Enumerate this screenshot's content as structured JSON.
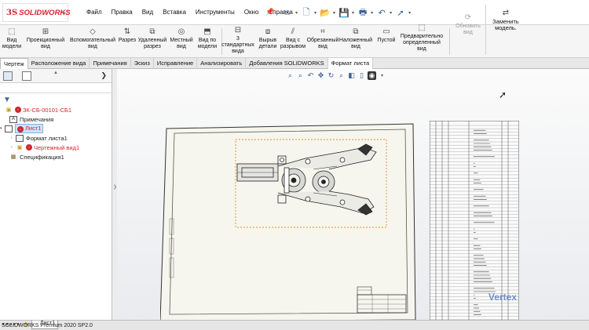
{
  "app": {
    "logo_ds": "3S",
    "logo_text": "SOLIDWORKS"
  },
  "menu": [
    "Файл",
    "Правка",
    "Вид",
    "Вставка",
    "Инструменты",
    "Окно",
    "Справка"
  ],
  "ribbon": {
    "buttons": [
      {
        "label": "Вид\nмодели",
        "icon": "model-view-icon"
      },
      {
        "label": "Проекционный\nвид",
        "icon": "projected-view-icon"
      },
      {
        "label": "Вспомогательный\nвид",
        "icon": "auxiliary-view-icon"
      },
      {
        "label": "Разрез",
        "icon": "section-view-icon"
      },
      {
        "label": "Удаленный\nразрез",
        "icon": "removed-section-icon"
      },
      {
        "label": "Местный\nвид",
        "icon": "detail-view-icon"
      },
      {
        "label": "Вид по\nмодели",
        "icon": "relative-view-icon"
      },
      {
        "label": "3\nстандартных\nвида",
        "icon": "standard-3-view-icon"
      },
      {
        "label": "Вырыв\nдетали",
        "icon": "break-out-icon"
      },
      {
        "label": "Вид с\nразрывом",
        "icon": "broken-view-icon"
      },
      {
        "label": "Обрезанный\nвид",
        "icon": "crop-view-icon"
      },
      {
        "label": "Наложенный\nвид",
        "icon": "alternate-position-icon"
      },
      {
        "label": "Пустой",
        "icon": "empty-view-icon"
      },
      {
        "label": "Предварительно\nопределенный\nвид",
        "icon": "predefined-view-icon"
      }
    ],
    "disabled_button": "Обновить\nвид",
    "replace_model": "Заменить\nмодель."
  },
  "tabs": [
    "Чертеж",
    "Расположение вида",
    "Примечания",
    "Эскиз",
    "Исправление",
    "Анализировать",
    "Добавления SOLIDWORKS",
    "Формат листа"
  ],
  "tree": {
    "root": "ЗК-СБ-00101-СБ1",
    "annotations": "Примечания",
    "sheet": "Лист1",
    "sheet_format": "Формат листа1",
    "drawing_view": "Чертежный вид1",
    "bom": "Спецификация1"
  },
  "bottom": {
    "sheet_tab": "Лист1",
    "status": "SOLIDWORKS Premium 2020 SP2.0"
  },
  "watermark": "Vertex",
  "colors": {
    "brand_red": "#d0242a",
    "selection_blue": "#cfe3f8",
    "view_boundary": "#e8892b"
  }
}
